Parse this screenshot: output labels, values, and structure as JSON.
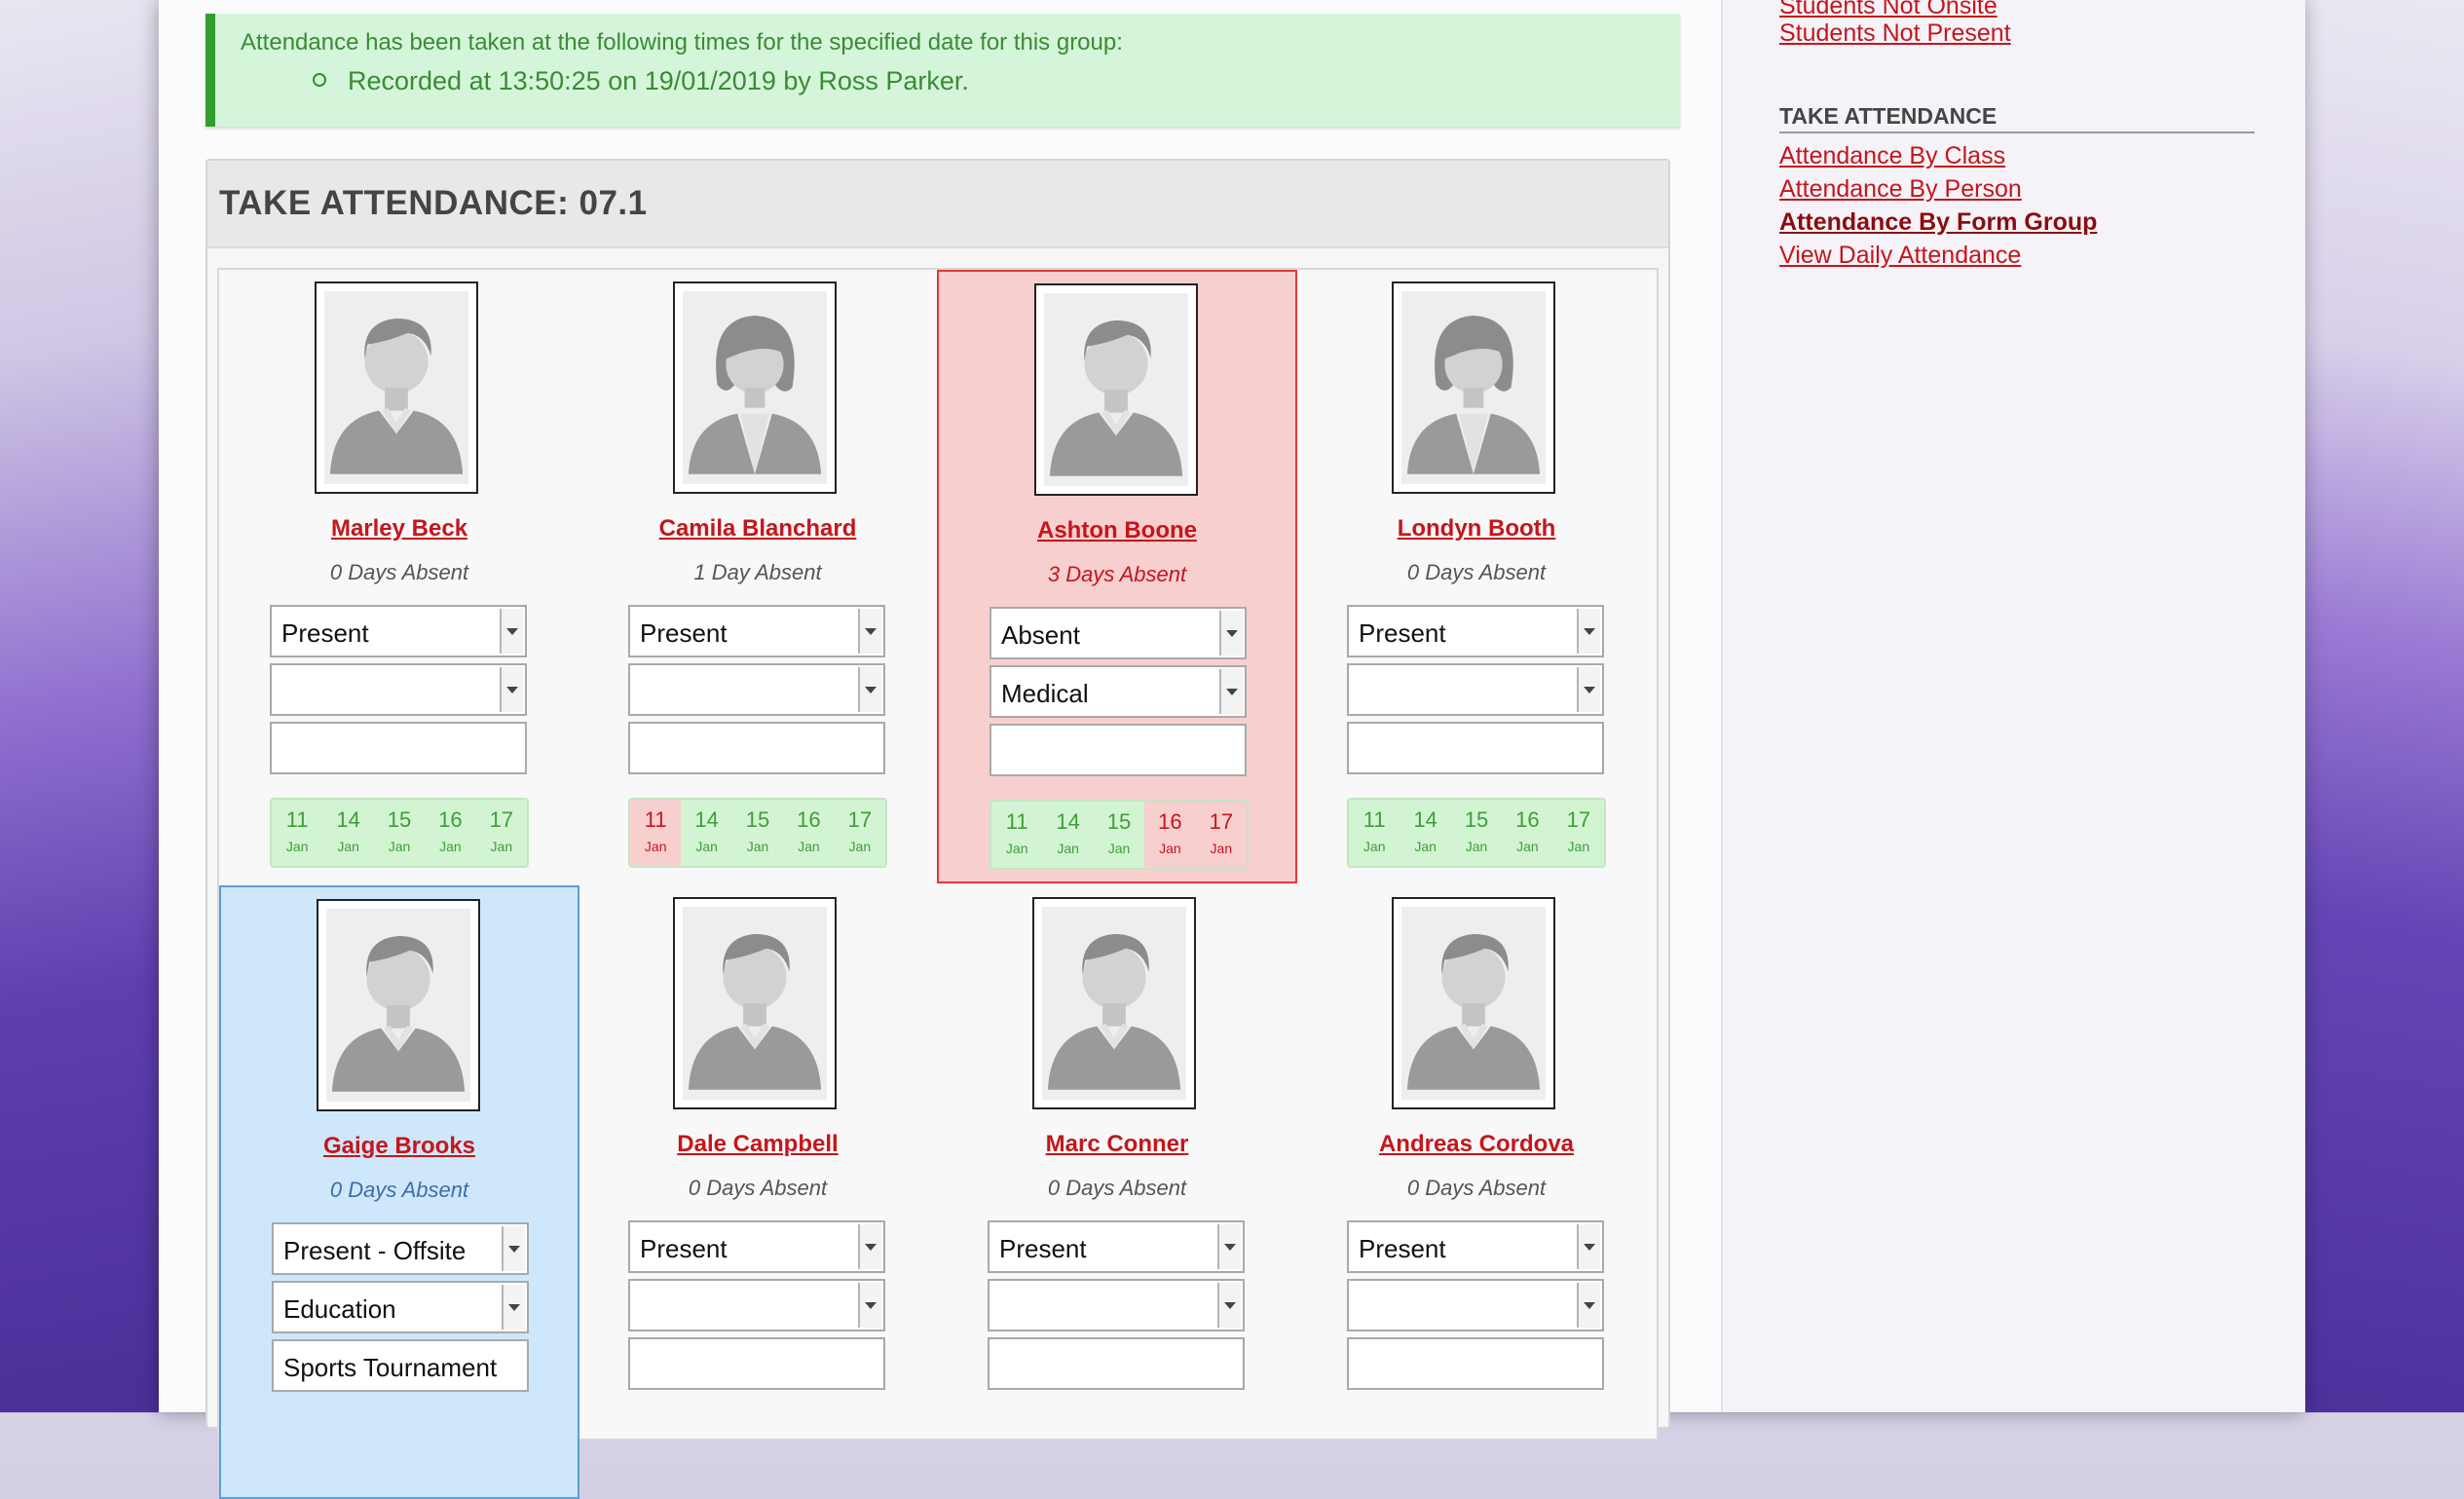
{
  "success": {
    "message": "Attendance has been taken at the following times for the specified date for this group:",
    "record": "Recorded at 13:50:25 on 19/01/2019 by Ross Parker."
  },
  "panel": {
    "title": "TAKE ATTENDANCE: 07.1"
  },
  "students": [
    {
      "name": "Marley Beck",
      "days": "0 Days Absent",
      "status": "Present",
      "reason": "",
      "comment": "",
      "gender": "male",
      "state": "normal",
      "history": [
        {
          "n": "11",
          "m": "Jan",
          "abs": false
        },
        {
          "n": "14",
          "m": "Jan",
          "abs": false
        },
        {
          "n": "15",
          "m": "Jan",
          "abs": false
        },
        {
          "n": "16",
          "m": "Jan",
          "abs": false
        },
        {
          "n": "17",
          "m": "Jan",
          "abs": false
        }
      ]
    },
    {
      "name": "Camila Blanchard",
      "days": "1 Day Absent",
      "status": "Present",
      "reason": "",
      "comment": "",
      "gender": "female",
      "state": "normal",
      "history": [
        {
          "n": "11",
          "m": "Jan",
          "abs": true
        },
        {
          "n": "14",
          "m": "Jan",
          "abs": false
        },
        {
          "n": "15",
          "m": "Jan",
          "abs": false
        },
        {
          "n": "16",
          "m": "Jan",
          "abs": false
        },
        {
          "n": "17",
          "m": "Jan",
          "abs": false
        }
      ]
    },
    {
      "name": "Ashton Boone",
      "days": "3 Days Absent",
      "status": "Absent",
      "reason": "Medical",
      "comment": "",
      "gender": "male",
      "state": "absent",
      "history": [
        {
          "n": "11",
          "m": "Jan",
          "abs": false
        },
        {
          "n": "14",
          "m": "Jan",
          "abs": false
        },
        {
          "n": "15",
          "m": "Jan",
          "abs": false
        },
        {
          "n": "16",
          "m": "Jan",
          "abs": true
        },
        {
          "n": "17",
          "m": "Jan",
          "abs": true
        }
      ]
    },
    {
      "name": "Londyn Booth",
      "days": "0 Days Absent",
      "status": "Present",
      "reason": "",
      "comment": "",
      "gender": "female",
      "state": "normal",
      "history": [
        {
          "n": "11",
          "m": "Jan",
          "abs": false
        },
        {
          "n": "14",
          "m": "Jan",
          "abs": false
        },
        {
          "n": "15",
          "m": "Jan",
          "abs": false
        },
        {
          "n": "16",
          "m": "Jan",
          "abs": false
        },
        {
          "n": "17",
          "m": "Jan",
          "abs": false
        }
      ]
    },
    {
      "name": "Gaige Brooks",
      "days": "0 Days Absent",
      "status": "Present - Offsite",
      "reason": "Education",
      "comment": "Sports Tournament",
      "gender": "male",
      "state": "offsite",
      "history": []
    },
    {
      "name": "Dale Campbell",
      "days": "0 Days Absent",
      "status": "Present",
      "reason": "",
      "comment": "",
      "gender": "male",
      "state": "normal",
      "history": []
    },
    {
      "name": "Marc Conner",
      "days": "0 Days Absent",
      "status": "Present",
      "reason": "",
      "comment": "",
      "gender": "male",
      "state": "normal",
      "history": []
    },
    {
      "name": "Andreas Cordova",
      "days": "0 Days Absent",
      "status": "Present",
      "reason": "",
      "comment": "",
      "gender": "male",
      "state": "normal",
      "history": []
    }
  ],
  "sidebar": {
    "top_links": [
      "Students Not Onsite",
      "Students Not Present"
    ],
    "heading": "TAKE ATTENDANCE",
    "links": [
      {
        "label": "Attendance By Class",
        "active": false
      },
      {
        "label": "Attendance By Person",
        "active": false
      },
      {
        "label": "Attendance By Form Group",
        "active": true
      },
      {
        "label": "View Daily Attendance",
        "active": false
      }
    ]
  }
}
